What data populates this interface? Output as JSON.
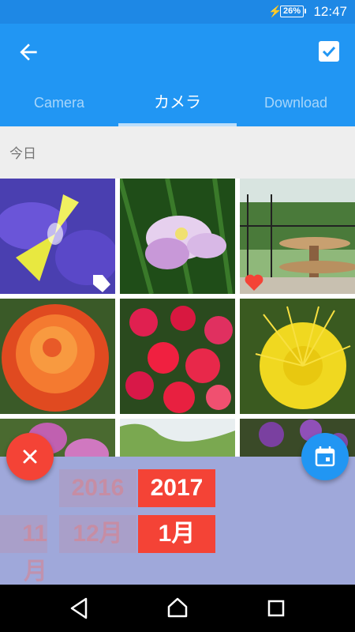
{
  "status_bar": {
    "battery": "26%",
    "time": "12:47",
    "bolt": "⚡"
  },
  "appbar": {
    "back_icon": "arrow-left-icon",
    "select_icon": "checkbox-checked-icon"
  },
  "tabs": [
    {
      "label": "Camera",
      "active": false
    },
    {
      "label": "カメラ",
      "active": true
    },
    {
      "label": "Download",
      "active": false
    }
  ],
  "section": {
    "date_label": "今日"
  },
  "date_picker": {
    "years": [
      "2016",
      "2017"
    ],
    "selected_year": "2017",
    "months": [
      "11月",
      "12月",
      "1月"
    ],
    "selected_month": "1月"
  },
  "fabs": {
    "close_icon": "close-icon",
    "calendar_icon": "calendar-icon"
  },
  "nav": {
    "back": "nav-back-icon",
    "home": "nav-home-icon",
    "recents": "nav-recents-icon"
  },
  "colors": {
    "primary": "#2196f3",
    "status": "#1e88e5",
    "accent": "#f44336",
    "picker_bg": "#9fa8da"
  }
}
